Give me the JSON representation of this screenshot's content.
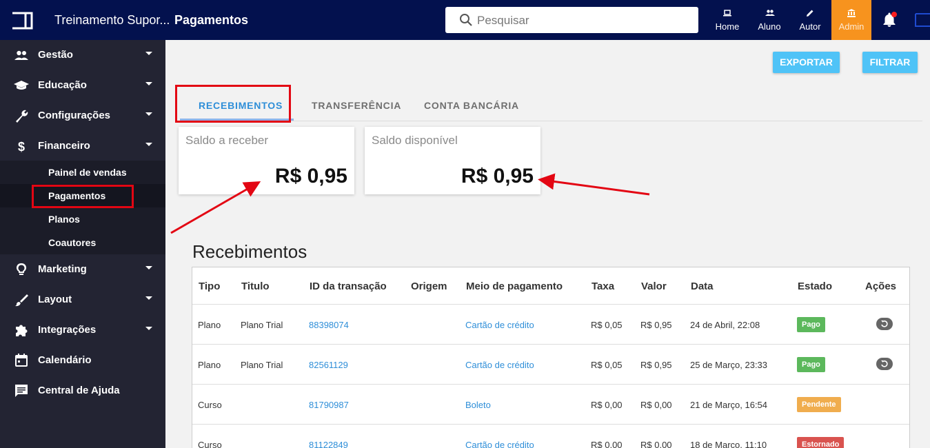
{
  "header": {
    "app_title": "Treinamento Supor...",
    "page_title": "Pagamentos",
    "search_placeholder": "Pesquisar",
    "nav": [
      {
        "label": "Home",
        "icon": "laptop-icon"
      },
      {
        "label": "Aluno",
        "icon": "people-icon"
      },
      {
        "label": "Autor",
        "icon": "pencil-icon"
      },
      {
        "label": "Admin",
        "icon": "bank-icon"
      }
    ]
  },
  "sidebar": {
    "items": [
      {
        "label": "Gestão",
        "icon": "people-icon"
      },
      {
        "label": "Educação",
        "icon": "graduation-cap-icon"
      },
      {
        "label": "Configurações",
        "icon": "wrench-icon"
      },
      {
        "label": "Financeiro",
        "icon": "dollar-icon"
      },
      {
        "label": "Marketing",
        "icon": "lightbulb-icon"
      },
      {
        "label": "Layout",
        "icon": "brush-icon"
      },
      {
        "label": "Integrações",
        "icon": "puzzle-icon"
      },
      {
        "label": "Calendário",
        "icon": "calendar-icon"
      },
      {
        "label": "Central de Ajuda",
        "icon": "chat-icon"
      }
    ],
    "sub_items": [
      "Painel de vendas",
      "Pagamentos",
      "Planos",
      "Coautores"
    ]
  },
  "actions": {
    "export": "EXPORTAR",
    "filter": "FILTRAR"
  },
  "tabs": [
    "RECEBIMENTOS",
    "TRANSFERÊNCIA",
    "CONTA BANCÁRIA"
  ],
  "cards": [
    {
      "title": "Saldo a receber",
      "value": "R$ 0,95"
    },
    {
      "title": "Saldo disponível",
      "value": "R$ 0,95"
    }
  ],
  "section_title": "Recebimentos",
  "table": {
    "headers": [
      "Tipo",
      "Titulo",
      "ID da transação",
      "Origem",
      "Meio de pagamento",
      "Taxa",
      "Valor",
      "Data",
      "Estado",
      "Ações"
    ],
    "rows": [
      {
        "tipo": "Plano",
        "titulo": "Plano Trial",
        "id": "88398074",
        "origem": "",
        "meio": "Cartão de crédito",
        "taxa": "R$ 0,05",
        "valor": "R$ 0,95",
        "data": "24 de Abril, 22:08",
        "estado": "Pago"
      },
      {
        "tipo": "Plano",
        "titulo": "Plano Trial",
        "id": "82561129",
        "origem": "",
        "meio": "Cartão de crédito",
        "taxa": "R$ 0,05",
        "valor": "R$ 0,95",
        "data": "25 de Março, 23:33",
        "estado": "Pago"
      },
      {
        "tipo": "Curso",
        "titulo": "",
        "id": "81790987",
        "origem": "",
        "meio": "Boleto",
        "taxa": "R$ 0,00",
        "valor": "R$ 0,00",
        "data": "21 de Março, 16:54",
        "estado": "Pendente"
      },
      {
        "tipo": "Curso",
        "titulo": "",
        "id": "81122849",
        "origem": "",
        "meio": "Cartão de crédito",
        "taxa": "R$ 0,00",
        "valor": "R$ 0,00",
        "data": "18 de Março, 11:10",
        "estado": "Estornado"
      }
    ]
  },
  "colors": {
    "topbar": "#03114e",
    "sidebar": "#232433",
    "admin_accent": "#f7931e",
    "button": "#4fc3f7",
    "link": "#2e8ed8",
    "annotation_red": "#e30613"
  }
}
